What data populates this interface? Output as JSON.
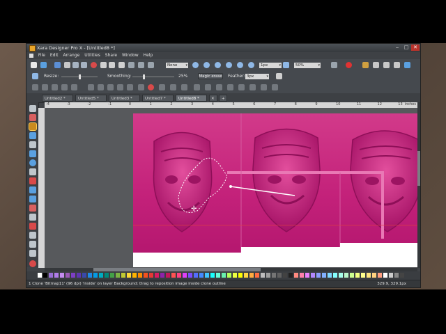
{
  "window": {
    "title": "Xara Designer Pro X - [Untitled8 *]"
  },
  "menu": [
    "File",
    "Edit",
    "Arrange",
    "Utilities",
    "Share",
    "Window",
    "Help"
  ],
  "toolbar": {
    "quality_combo": "None",
    "line_width_combo": "1px",
    "zoom_combo": "50%"
  },
  "infobar": {
    "resize_label": "Resize:",
    "smoothing_label": "Smoothing:",
    "smoothing_value": "25%",
    "magic_erase_label": "Magic erase",
    "feather_label": "Feather:",
    "feather_value": "3px"
  },
  "tabs": [
    {
      "label": "Untitled2 *",
      "active": false
    },
    {
      "label": "Untitled5 *",
      "active": false
    },
    {
      "label": "Untitled3 *",
      "active": false
    },
    {
      "label": "Untitled7 *",
      "active": false
    },
    {
      "label": "Untitled8 *",
      "active": true
    }
  ],
  "ruler": {
    "units": "inches",
    "ticks": [
      "-4",
      "-3",
      "-2",
      "-1",
      "0",
      "1",
      "2",
      "3",
      "4",
      "5",
      "6",
      "7",
      "8",
      "9",
      "10",
      "11",
      "12",
      "13"
    ]
  },
  "status": {
    "message": "1 Clone 'Bitmap11' (96 dpi) 'inside' on layer Background: Drag to reposition image inside clone outline",
    "coords": "329.9, 329.1px"
  },
  "colors": {
    "magenta": "#c8237c",
    "accent_orange": "#c98b1f"
  }
}
